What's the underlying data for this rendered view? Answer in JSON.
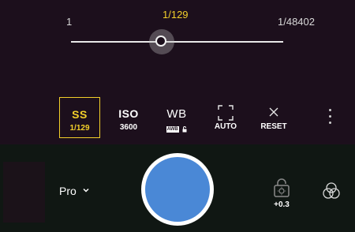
{
  "slider": {
    "min_label": "1",
    "current_label": "1/129",
    "max_label": "1/48402",
    "position_fraction": 0.43
  },
  "controls": [
    {
      "label": "SS",
      "value": "1/129",
      "active": true
    },
    {
      "label": "ISO",
      "value": "3600",
      "active": false
    },
    {
      "label": "WB",
      "value": "AWB",
      "active": false
    },
    {
      "label": "",
      "value": "AUTO",
      "active": false
    },
    {
      "label": "",
      "value": "RESET",
      "active": false
    }
  ],
  "bottom": {
    "mode_label": "Pro",
    "exposure_value": "+0.3"
  },
  "colors": {
    "accent": "#f2cf2a",
    "shutter": "#4a88d6",
    "viewfinder_bg": "#1c0f1c",
    "bottom_bg": "#101713"
  },
  "icons": {
    "focus": "focus-frame-icon",
    "reset": "close-icon",
    "more": "more-vertical-icon",
    "mode_chevron": "chevron-down-icon",
    "exposure": "exposure-lock-icon",
    "filters": "filters-icon"
  }
}
